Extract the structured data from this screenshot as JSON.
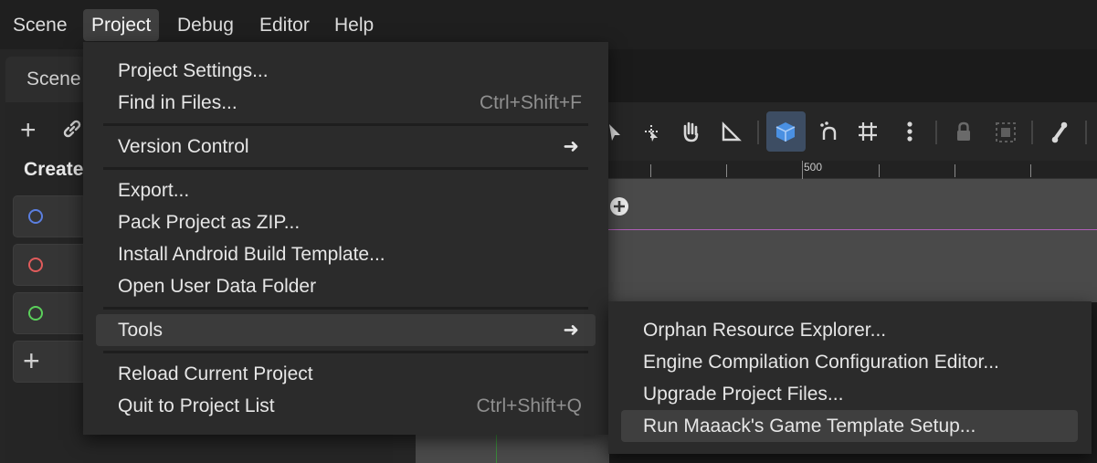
{
  "menubar": {
    "items": [
      "Scene",
      "Project",
      "Debug",
      "Editor",
      "Help"
    ],
    "active": "Project"
  },
  "scene_dock": {
    "tab_label": "Scene",
    "create_label": "Create",
    "node_buttons": [
      {
        "icon": "circle-node-icon",
        "color": "#5b7fe0"
      },
      {
        "icon": "circle-node-icon",
        "color": "#e05b5b"
      },
      {
        "icon": "circle-node-icon",
        "color": "#5bd05b"
      },
      {
        "icon": "plus-icon",
        "color": "#d0d0d0"
      }
    ]
  },
  "viewport": {
    "ruler_label": "500",
    "guide_color": "#b05fb8",
    "active_tool_color": "#4a90e2"
  },
  "project_menu": {
    "items": [
      {
        "label": "Project Settings...",
        "shortcut": ""
      },
      {
        "label": "Find in Files...",
        "shortcut": "Ctrl+Shift+F"
      },
      {
        "label": "Version Control",
        "submenu": true
      },
      {
        "label": "Export...",
        "shortcut": ""
      },
      {
        "label": "Pack Project as ZIP...",
        "shortcut": ""
      },
      {
        "label": "Install Android Build Template...",
        "shortcut": ""
      },
      {
        "label": "Open User Data Folder",
        "shortcut": ""
      },
      {
        "label": "Tools",
        "submenu": true,
        "highlighted": true
      },
      {
        "label": "Reload Current Project",
        "shortcut": ""
      },
      {
        "label": "Quit to Project List",
        "shortcut": "Ctrl+Shift+Q"
      }
    ]
  },
  "tools_submenu": {
    "items": [
      {
        "label": "Orphan Resource Explorer..."
      },
      {
        "label": "Engine Compilation Configuration Editor..."
      },
      {
        "label": "Upgrade Project Files..."
      },
      {
        "label": "Run Maaack's Game Template Setup...",
        "highlighted": true
      }
    ]
  }
}
